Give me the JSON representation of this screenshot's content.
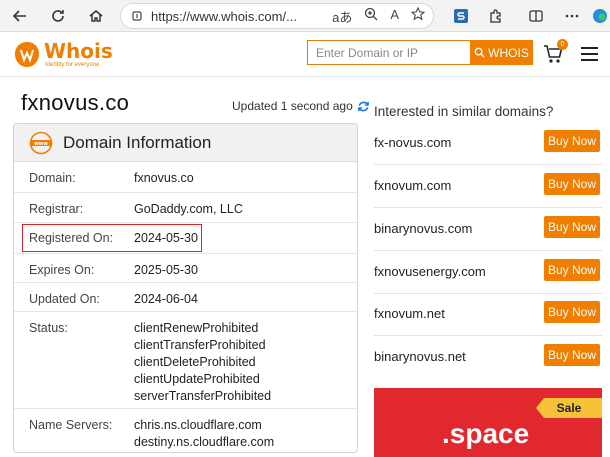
{
  "browser": {
    "url": "https://www.whois.com/...",
    "reader_label": "aあ",
    "read_aloud_label": "A"
  },
  "site": {
    "logo_text": "Whois",
    "logo_tagline": "Identity for everyone",
    "search_placeholder": "Enter Domain or IP",
    "search_button": "WHOIS",
    "cart_count": "0"
  },
  "domain": {
    "name": "fxnovus.co",
    "updated": "Updated 1 second ago"
  },
  "info_card": {
    "title": "Domain Information",
    "rows": [
      {
        "label": "Domain:",
        "value": "fxnovus.co"
      },
      {
        "label": "Registrar:",
        "value": "GoDaddy.com, LLC"
      },
      {
        "label": "Registered On:",
        "value": "2024-05-30"
      },
      {
        "label": "Expires On:",
        "value": "2025-05-30"
      },
      {
        "label": "Updated On:",
        "value": "2024-06-04"
      },
      {
        "label": "Status:",
        "values": [
          "clientRenewProhibited",
          "clientTransferProhibited",
          "clientDeleteProhibited",
          "clientUpdateProhibited",
          "serverTransferProhibited"
        ]
      },
      {
        "label": "Name Servers:",
        "values": [
          "chris.ns.cloudflare.com",
          "destiny.ns.cloudflare.com"
        ]
      }
    ]
  },
  "similar": {
    "heading": "Interested in similar domains?",
    "buy_label": "Buy Now",
    "items": [
      "fx-novus.com",
      "fxnovum.com",
      "binarynovus.com",
      "fxnovusenergy.com",
      "fxnovum.net",
      "binarynovus.net"
    ]
  },
  "promo": {
    "badge": "Sale",
    "tld": ".space"
  },
  "colors": {
    "brand": "#f07e00",
    "highlight": "#d62828",
    "promo_bg": "#e0282e",
    "sale_badge": "#f6c338"
  }
}
